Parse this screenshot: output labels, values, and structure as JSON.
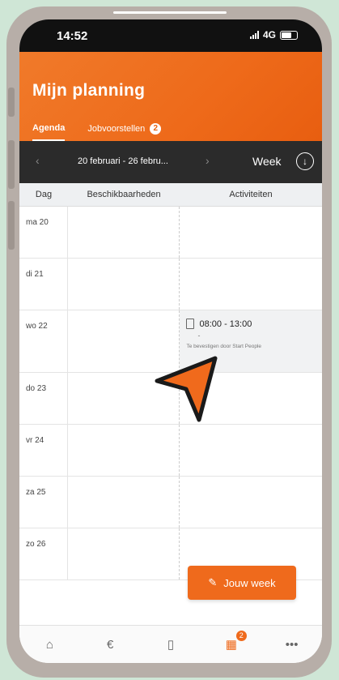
{
  "status": {
    "time": "14:52",
    "network": "4G"
  },
  "header": {
    "title": "Mijn planning"
  },
  "tabs": [
    {
      "label": "Agenda",
      "active": true
    },
    {
      "label": "Jobvoorstellen",
      "active": false,
      "badge": "2"
    }
  ],
  "week": {
    "range": "20 februari - 26 febru...",
    "view": "Week"
  },
  "table": {
    "headers": [
      "Dag",
      "Beschikbaarheden",
      "Activiteiten"
    ],
    "rows": [
      {
        "day": "ma 20"
      },
      {
        "day": "di 21"
      },
      {
        "day": "wo 22",
        "activity": {
          "time": "08:00 - 13:00",
          "dash": "-",
          "note": "Te bevestigen door Start People"
        }
      },
      {
        "day": "do 23"
      },
      {
        "day": "vr 24"
      },
      {
        "day": "za 25"
      },
      {
        "day": "zo 26"
      }
    ]
  },
  "fab": {
    "label": "Jouw week"
  },
  "nav": {
    "badge": "2"
  },
  "colors": {
    "accent": "#ef6a1c",
    "dark": "#2b2b2b"
  }
}
